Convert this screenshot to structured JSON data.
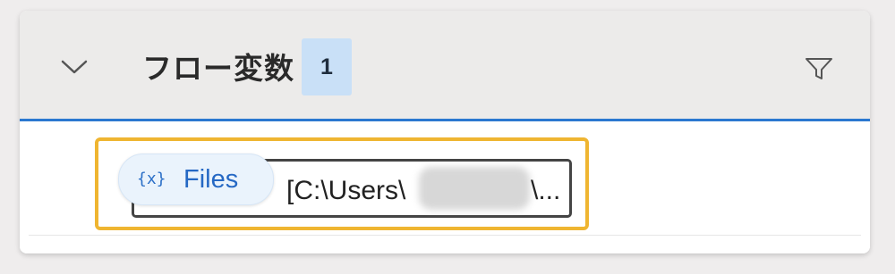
{
  "header": {
    "title": "フロー変数",
    "count": "1",
    "collapse_icon": "chevron-down-icon",
    "filter_icon": "filter-icon"
  },
  "variable": {
    "icon_text": "{x}",
    "name": "Files",
    "value_visible_start": "[C:\\Users\\",
    "value_visible_end": "\\..."
  },
  "colors": {
    "accent_line": "#2b78d0",
    "badge_bg": "#c9e0f7",
    "highlight_border": "#efb531",
    "chip_text": "#2568c4"
  }
}
